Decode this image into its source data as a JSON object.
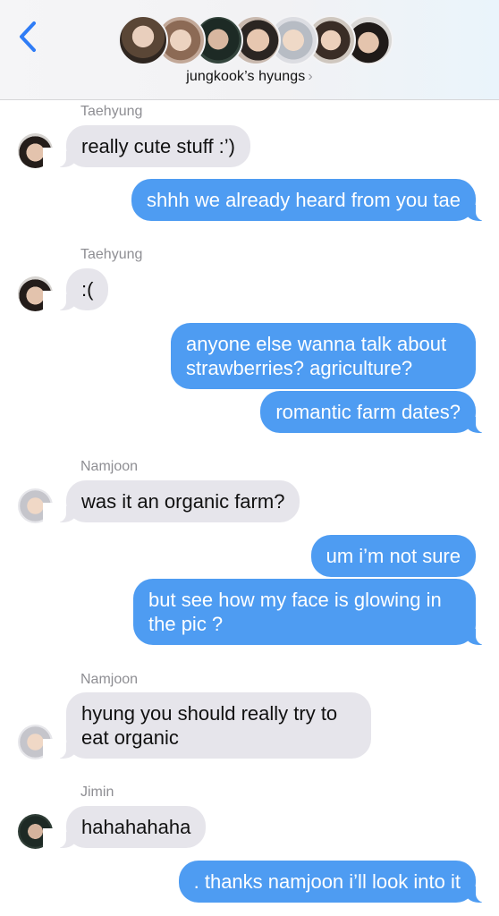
{
  "header": {
    "back_icon": "chevron-left-icon",
    "group_name": "jungkook’s hyungs",
    "chevron": "›",
    "accent_color": "#2f7cf6",
    "avatar_count": 7
  },
  "messages": [
    {
      "sender": "Taehyung",
      "direction": "incoming",
      "text": "really cute stuff :’)"
    },
    {
      "direction": "outgoing",
      "text": "shhh we already heard from you tae"
    },
    {
      "sender": "Taehyung",
      "direction": "incoming",
      "text": ":("
    },
    {
      "direction": "outgoing",
      "text": "anyone else wanna talk about strawberries? agriculture?"
    },
    {
      "direction": "outgoing",
      "text": "romantic farm dates?"
    },
    {
      "sender": "Namjoon",
      "direction": "incoming",
      "text": "was it an organic farm?"
    },
    {
      "direction": "outgoing",
      "text": "um i’m not sure"
    },
    {
      "direction": "outgoing",
      "text": "but see how my face is glowing in the pic ?"
    },
    {
      "sender": "Namjoon",
      "direction": "incoming",
      "text": "hyung you should really try to eat organic"
    },
    {
      "sender": "Jimin",
      "direction": "incoming",
      "text": "hahahahaha"
    },
    {
      "direction": "outgoing",
      "text": ". thanks namjoon i’ll look into it"
    }
  ],
  "colors": {
    "incoming_bubble": "#e6e5eb",
    "outgoing_bubble": "#4e9cf2",
    "sender_label": "#8e8e93"
  }
}
